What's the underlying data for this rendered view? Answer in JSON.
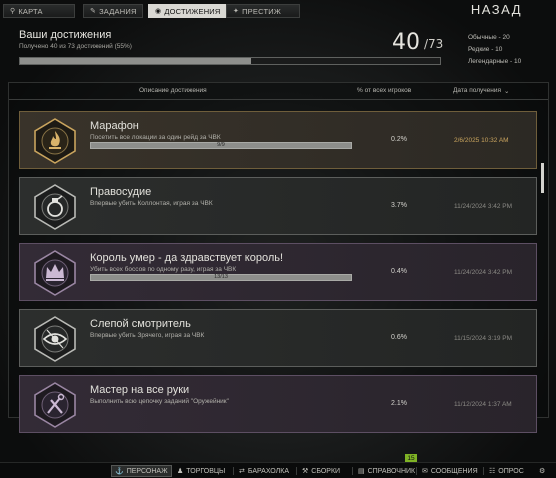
{
  "tabs": [
    {
      "label": "КАРТА",
      "icon": "map-pin-icon"
    },
    {
      "label": "ЗАДАНИЯ",
      "icon": "pencil-icon"
    },
    {
      "label": "ДОСТИЖЕНИЯ",
      "icon": "achievement-icon"
    },
    {
      "label": "ПРЕСТИЖ",
      "icon": "prestige-icon"
    }
  ],
  "back_label": "НАЗАД",
  "summary": {
    "title": "Ваши достижения",
    "subtitle": "Получено 40 из 73 достижений (55%)",
    "progress": 0.55,
    "count": "40",
    "total": "/73",
    "common": "Обычные - 20",
    "rare": "Редкие - 10",
    "legendary": "Легендарные - 10"
  },
  "columns": {
    "description": "Описание достижения",
    "percent": "% от всех игроков",
    "date": "Дата получения"
  },
  "achievements": [
    {
      "name": "Марафон",
      "desc": "Посетить все локации за один рейд за ЧВК",
      "progress": "9/9",
      "percent": "0.2%",
      "date": "2/6/2025 10:32 AM",
      "rarity": "legendary",
      "icon": "flame-icon"
    },
    {
      "name": "Правосудие",
      "desc": "Впервые убить Коллонтая, играя за ЧВК",
      "progress": "",
      "percent": "3.7%",
      "date": "11/24/2024 3:42 PM",
      "rarity": "common",
      "icon": "grenade-icon"
    },
    {
      "name": "Король умер - да здравствует король!",
      "desc": "Убить всех боссов по одному разу, играя за ЧВК",
      "progress": "13/13",
      "percent": "0.4%",
      "date": "11/24/2024 3:42 PM",
      "rarity": "rare",
      "icon": "crown-icon"
    },
    {
      "name": "Слепой смотритель",
      "desc": "Впервые убить Зрячего, играя за ЧВК",
      "progress": "",
      "percent": "0.6%",
      "date": "11/15/2024 3:19 PM",
      "rarity": "common",
      "icon": "eye-icon"
    },
    {
      "name": "Мастер на все руки",
      "desc": "Выполнить всю цепочку заданий \"Оружейник\"",
      "progress": "",
      "percent": "2.1%",
      "date": "11/12/2024 1:37 AM",
      "rarity": "rare",
      "icon": "tools-icon"
    }
  ],
  "bottom": [
    {
      "label": "ПЕРСОНАЖ",
      "icon": "character-icon"
    },
    {
      "label": "ТОРГОВЦЫ",
      "icon": "traders-icon"
    },
    {
      "label": "БАРАХОЛКА",
      "icon": "flea-market-icon"
    },
    {
      "label": "СБОРКИ",
      "icon": "builds-icon"
    },
    {
      "label": "СПРАВОЧНИК",
      "icon": "handbook-icon"
    },
    {
      "label": "СООБЩЕНИЯ",
      "icon": "messages-icon"
    },
    {
      "label": "ОПРОС",
      "icon": "survey-icon"
    }
  ],
  "messages_badge": "15",
  "colors": {
    "legendary": "#c9a45e",
    "rare": "#5d4f63",
    "common": "#5c5e5c",
    "notify": "#7fb325"
  }
}
